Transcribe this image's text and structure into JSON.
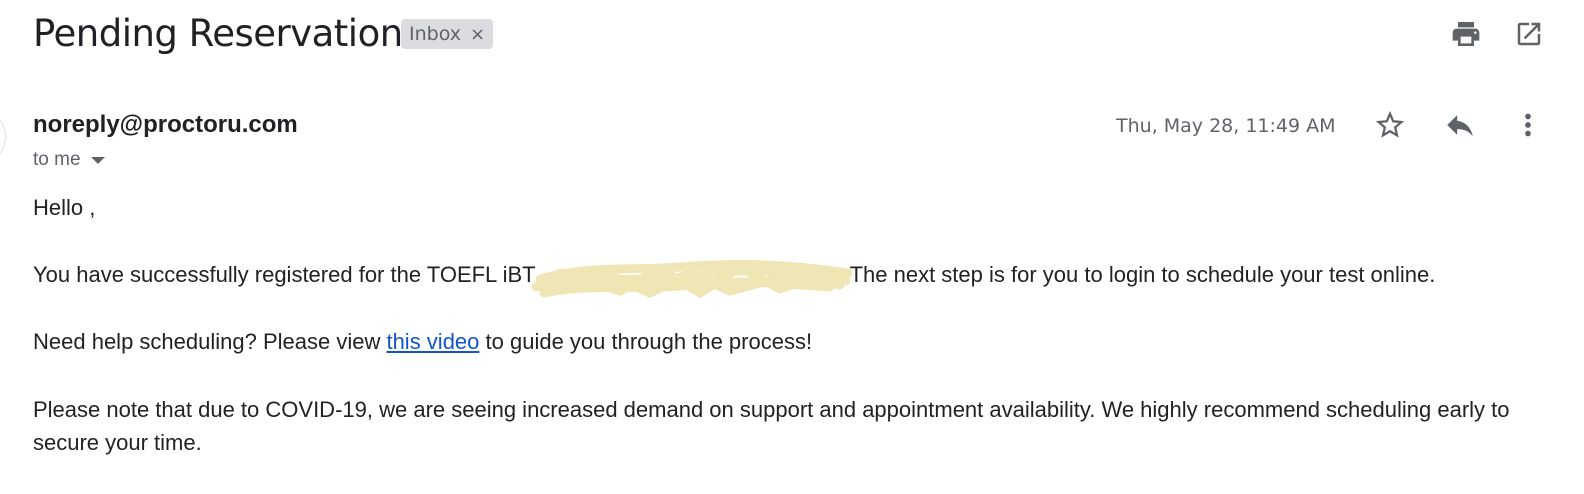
{
  "header": {
    "subject": "Pending Reservation",
    "label": "Inbox",
    "label_remove_glyph": "×",
    "actions": [
      {
        "name": "print-icon"
      },
      {
        "name": "open-in-new-window-icon"
      }
    ]
  },
  "message": {
    "sender": "noreply@proctoru.com",
    "recipient_summary": "to me",
    "date": "Thu, May 28, 11:49 AM",
    "actions": [
      {
        "name": "star-icon"
      },
      {
        "name": "reply-icon"
      },
      {
        "name": "more-vertical-icon"
      }
    ],
    "body": {
      "greeting": "Hello ,",
      "p1_before": "You have successfully registered for the TOEFL iBT",
      "p1_after": "The next step is for you to login to schedule your test online.",
      "p2_before": "Need help scheduling? Please view ",
      "p2_link": "this video",
      "p2_after": " to guide you through the process!",
      "p3_line1": "Please note that due to COVID-19, we are seeing increased demand on support and appointment availability. We highly recommend scheduling early to",
      "p3_line2": "secure your time."
    }
  },
  "colors": {
    "redaction": "#f0e4b0",
    "link": "#1155cc",
    "chip_bg": "#dadce0"
  }
}
